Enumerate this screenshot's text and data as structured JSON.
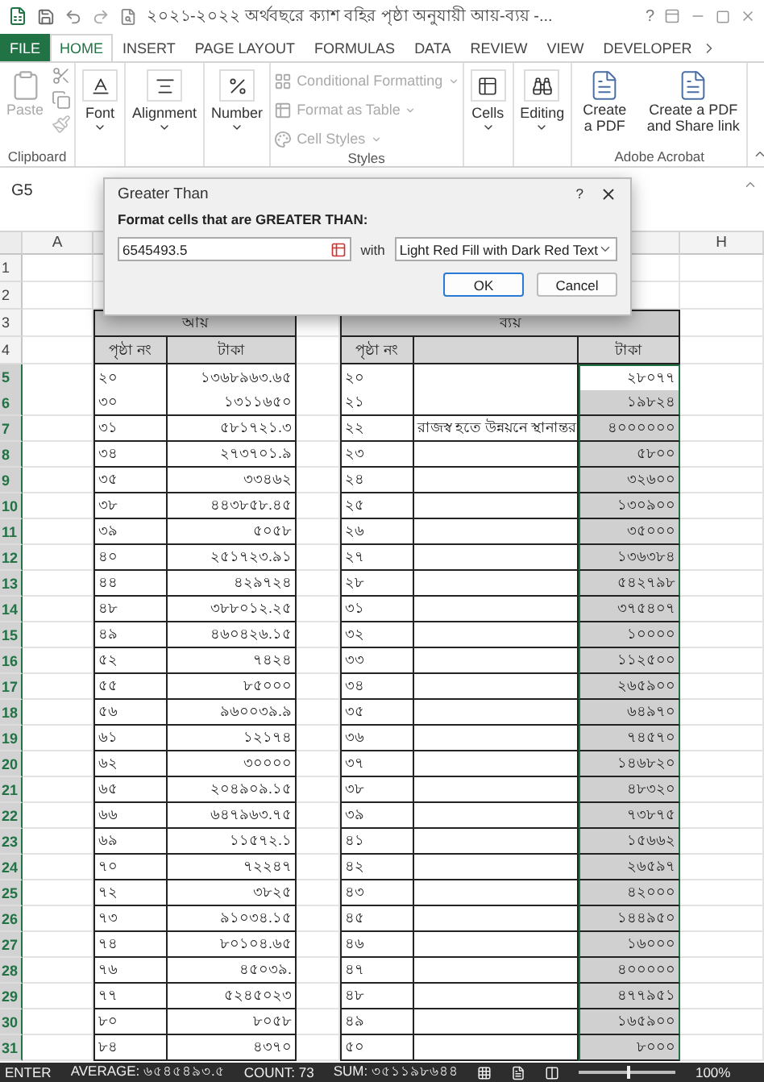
{
  "title_bar": {
    "title": "২০২১-২০২২ অর্থবছরে ক্যাশ বহির পৃষ্ঠা অনুযায়ী আয়-ব্যয় -...",
    "help": "?"
  },
  "tabs": [
    {
      "label": "FILE",
      "kind": "file",
      "selected": false
    },
    {
      "label": "HOME",
      "kind": "tab",
      "selected": true
    },
    {
      "label": "INSERT",
      "kind": "tab",
      "selected": false
    },
    {
      "label": "PAGE LAYOUT",
      "kind": "tab",
      "selected": false
    },
    {
      "label": "FORMULAS",
      "kind": "tab",
      "selected": false
    },
    {
      "label": "DATA",
      "kind": "tab",
      "selected": false
    },
    {
      "label": "REVIEW",
      "kind": "tab",
      "selected": false
    },
    {
      "label": "VIEW",
      "kind": "tab",
      "selected": false
    },
    {
      "label": "DEVELOPER",
      "kind": "tab",
      "selected": false
    }
  ],
  "ribbon": {
    "groups": [
      {
        "kind": "clipboard",
        "label": "Clipboard",
        "items": [
          {
            "label": "Paste",
            "disabled": true
          }
        ]
      },
      {
        "kind": "font",
        "label": "Font"
      },
      {
        "kind": "alignment",
        "label": "Alignment"
      },
      {
        "kind": "number",
        "label": "Number"
      },
      {
        "kind": "styles",
        "label": "Styles",
        "items": [
          {
            "label": "Conditional Formatting",
            "disabled": true
          },
          {
            "label": "Format as Table",
            "disabled": true
          },
          {
            "label": "Cell Styles",
            "disabled": true
          }
        ]
      },
      {
        "kind": "cells",
        "label": "Cells"
      },
      {
        "kind": "editing",
        "label": "Editing"
      },
      {
        "kind": "acrobat",
        "label": "Adobe Acrobat",
        "items": [
          {
            "label": "Create a PDF"
          },
          {
            "label": "Create a PDF and Share link"
          }
        ]
      }
    ]
  },
  "name_box": "G5",
  "dialog": {
    "title": "Greater Than",
    "help": "?",
    "prompt": "Format cells that are GREATER THAN:",
    "value": "6545493.5",
    "with_label": "with",
    "format": "Light Red Fill with Dark Red Text",
    "buttons": [
      {
        "label": "OK",
        "default": true
      },
      {
        "label": "Cancel",
        "default": false
      }
    ]
  },
  "sheet": {
    "columns": [
      "A",
      "H"
    ],
    "rows": [
      {
        "number": "1",
        "kind": "blank",
        "selected": false
      },
      {
        "number": "2",
        "kind": "blank",
        "selected": false
      },
      {
        "number": "3",
        "kind": "group_header",
        "selected": false,
        "income": "আয়",
        "expense": "ব্যয়"
      },
      {
        "number": "4",
        "kind": "column_header",
        "selected": false,
        "income_page": "পৃষ্ঠা নং",
        "income_amount": "টাকা",
        "expense_page": "পৃষ্ঠা নং",
        "expense_amount": "টাকা"
      },
      {
        "number": "5",
        "kind": "entry",
        "selected": true,
        "active": true,
        "income_page": "২০",
        "income_amount": "১৩৬৮৯৬৩.৬৫",
        "expense_page": "২০",
        "expense_amount": "২৮০৭৭"
      },
      {
        "number": "6",
        "kind": "entry",
        "selected": true,
        "active": false,
        "income_page": "৩০",
        "income_amount": "১৩১১৬৫০",
        "expense_page": "২১",
        "expense_amount": "১৯৮২৪"
      },
      {
        "number": "7",
        "kind": "entry",
        "selected": true,
        "active": false,
        "income_page": "৩১",
        "income_amount": "৫৮১৭২১.৩",
        "expense_page": "২২",
        "expense_note": "রাজস্ব হতে উন্নয়নে স্থানান্তর",
        "expense_amount": "৪০০০০০০"
      },
      {
        "number": "8",
        "kind": "entry",
        "selected": true,
        "active": false,
        "income_page": "৩৪",
        "income_amount": "২৭৩৭০১.৯",
        "expense_page": "২৩",
        "expense_amount": "৫৮০০"
      },
      {
        "number": "9",
        "kind": "entry",
        "selected": true,
        "active": false,
        "income_page": "৩৫",
        "income_amount": "৩৩৪৬২",
        "expense_page": "২৪",
        "expense_amount": "৩২৬০০"
      },
      {
        "number": "10",
        "kind": "entry",
        "selected": true,
        "active": false,
        "income_page": "৩৮",
        "income_amount": "৪৪৩৮৫৮.৪৫",
        "expense_page": "২৫",
        "expense_amount": "১৩০৯০০"
      },
      {
        "number": "11",
        "kind": "entry",
        "selected": true,
        "active": false,
        "income_page": "৩৯",
        "income_amount": "৫০৫৮",
        "expense_page": "২৬",
        "expense_amount": "৩৫০০০"
      },
      {
        "number": "12",
        "kind": "entry",
        "selected": true,
        "active": false,
        "income_page": "৪০",
        "income_amount": "২৫১৭২৩.৯১",
        "expense_page": "২৭",
        "expense_amount": "১৩৬৩৮৪"
      },
      {
        "number": "13",
        "kind": "entry",
        "selected": true,
        "active": false,
        "income_page": "৪৪",
        "income_amount": "৪২৯৭২৪",
        "expense_page": "২৮",
        "expense_amount": "৫৪২৭৯৮"
      },
      {
        "number": "14",
        "kind": "entry",
        "selected": true,
        "active": false,
        "income_page": "৪৮",
        "income_amount": "৩৮৮০১২.২৫",
        "expense_page": "৩১",
        "expense_amount": "৩৭৫৪০৭"
      },
      {
        "number": "15",
        "kind": "entry",
        "selected": true,
        "active": false,
        "income_page": "৪৯",
        "income_amount": "৪৬০৪২৬.১৫",
        "expense_page": "৩২",
        "expense_amount": "১০০০০"
      },
      {
        "number": "16",
        "kind": "entry",
        "selected": true,
        "active": false,
        "income_page": "৫২",
        "income_amount": "৭৪২৪",
        "expense_page": "৩৩",
        "expense_amount": "১১২৫০০"
      },
      {
        "number": "17",
        "kind": "entry",
        "selected": true,
        "active": false,
        "income_page": "৫৫",
        "income_amount": "৮৫০০০",
        "expense_page": "৩৪",
        "expense_amount": "২৬৫৯০০"
      },
      {
        "number": "18",
        "kind": "entry",
        "selected": true,
        "active": false,
        "income_page": "৫৬",
        "income_amount": "৯৬০০৩৯.৯",
        "expense_page": "৩৫",
        "expense_amount": "৬৪৯৭০"
      },
      {
        "number": "19",
        "kind": "entry",
        "selected": true,
        "active": false,
        "income_page": "৬১",
        "income_amount": "১২১৭৪",
        "expense_page": "৩৬",
        "expense_amount": "৭৪৫৭০"
      },
      {
        "number": "20",
        "kind": "entry",
        "selected": true,
        "active": false,
        "income_page": "৬২",
        "income_amount": "৩০০০০",
        "expense_page": "৩৭",
        "expense_amount": "১৪৬৮২০"
      },
      {
        "number": "21",
        "kind": "entry",
        "selected": true,
        "active": false,
        "income_page": "৬৫",
        "income_amount": "২০৪৯০৯.১৫",
        "expense_page": "৩৮",
        "expense_amount": "৪৮৩২০"
      },
      {
        "number": "22",
        "kind": "entry",
        "selected": true,
        "active": false,
        "income_page": "৬৬",
        "income_amount": "৬৪৭৯৬৩.৭৫",
        "expense_page": "৩৯",
        "expense_amount": "৭৩৮৭৫"
      },
      {
        "number": "23",
        "kind": "entry",
        "selected": true,
        "active": false,
        "income_page": "৬৯",
        "income_amount": "১১৫৭২.১",
        "expense_page": "৪১",
        "expense_amount": "১৫৬৬২"
      },
      {
        "number": "24",
        "kind": "entry",
        "selected": true,
        "active": false,
        "income_page": "৭০",
        "income_amount": "৭২২৪৭",
        "expense_page": "৪২",
        "expense_amount": "২৬৫৯৭"
      },
      {
        "number": "25",
        "kind": "entry",
        "selected": true,
        "active": false,
        "income_page": "৭২",
        "income_amount": "৩৮২৫",
        "expense_page": "৪৩",
        "expense_amount": "৪২০০০"
      },
      {
        "number": "26",
        "kind": "entry",
        "selected": true,
        "active": false,
        "income_page": "৭৩",
        "income_amount": "৯১০৩৪.১৫",
        "expense_page": "৪৫",
        "expense_amount": "১৪৪৯৫০"
      },
      {
        "number": "27",
        "kind": "entry",
        "selected": true,
        "active": false,
        "income_page": "৭৪",
        "income_amount": "৮০১০৪.৬৫",
        "expense_page": "৪৬",
        "expense_amount": "১৬০০০"
      },
      {
        "number": "28",
        "kind": "entry",
        "selected": true,
        "active": false,
        "income_page": "৭৬",
        "income_amount": "৪৫০৩৯.",
        "expense_page": "৪৭",
        "expense_amount": "৪০০০০০"
      },
      {
        "number": "29",
        "kind": "entry",
        "selected": true,
        "active": false,
        "income_page": "৭৭",
        "income_amount": "৫২৪৫০২৩",
        "expense_page": "৪৮",
        "expense_amount": "৪৭৭৯৫১"
      },
      {
        "number": "30",
        "kind": "entry",
        "selected": true,
        "active": false,
        "income_page": "৮০",
        "income_amount": "৮০৫৮",
        "expense_page": "৪৯",
        "expense_amount": "১৬৫৯০০"
      },
      {
        "number": "31",
        "kind": "entry",
        "selected": true,
        "active": false,
        "income_page": "৮৪",
        "income_amount": "৪৩৭০",
        "expense_page": "৫০",
        "expense_amount": "৮০০০"
      }
    ]
  },
  "status_bar": {
    "mode": "ENTER",
    "average": "AVERAGE: ৬৫৪৫৪৯৩.৫",
    "count": "COUNT: 73",
    "sum": "SUM: ৩৫১১৯৮৬৪৪",
    "zoom": {
      "level": 0.5,
      "reading": "100%"
    }
  }
}
